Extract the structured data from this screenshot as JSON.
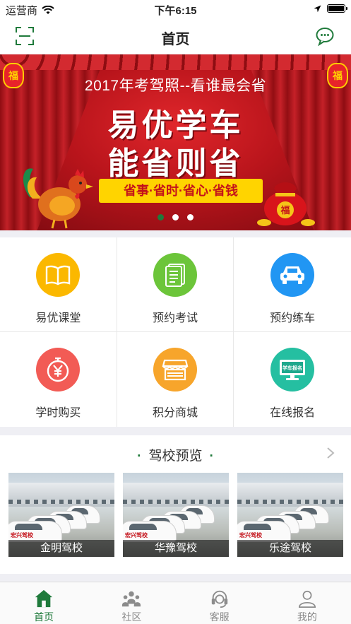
{
  "status_bar": {
    "carrier": "运营商",
    "time": "下午6:15"
  },
  "nav": {
    "title": "首页"
  },
  "banner": {
    "subtitle": "2017年考驾照--看谁最会省",
    "title_line1": "易优学车",
    "title_line2": "能省则省",
    "slogan": "省事·省时·省心·省钱",
    "lantern_char": "福",
    "pages": 3,
    "active_page": 1
  },
  "features": [
    {
      "label": "易优课堂",
      "icon": "book-icon",
      "color": "#fbb800"
    },
    {
      "label": "预约考试",
      "icon": "document-icon",
      "color": "#6cc53a"
    },
    {
      "label": "预约练车",
      "icon": "car-icon",
      "color": "#2196f3"
    },
    {
      "label": "学时购买",
      "icon": "yen-stopwatch-icon",
      "color": "#f25b55"
    },
    {
      "label": "积分商城",
      "icon": "shop-icon",
      "color": "#f7a52b"
    },
    {
      "label": "在线报名",
      "icon": "monitor-signup-icon",
      "color": "#25bfa1"
    }
  ],
  "monitor_text": "学车报名",
  "schools_section": {
    "title": "驾校预览",
    "car_tag": "宏兴驾校",
    "schools": [
      {
        "name": "金明驾校"
      },
      {
        "name": "华豫驾校"
      },
      {
        "name": "乐途驾校"
      }
    ]
  },
  "tabs": [
    {
      "label": "首页",
      "icon": "home-icon",
      "active": true
    },
    {
      "label": "社区",
      "icon": "community-icon",
      "active": false
    },
    {
      "label": "客服",
      "icon": "headset-icon",
      "active": false
    },
    {
      "label": "我的",
      "icon": "user-icon",
      "active": false
    }
  ],
  "colors": {
    "brand_green": "#1f7a3b",
    "banner_red": "#c4121a"
  }
}
